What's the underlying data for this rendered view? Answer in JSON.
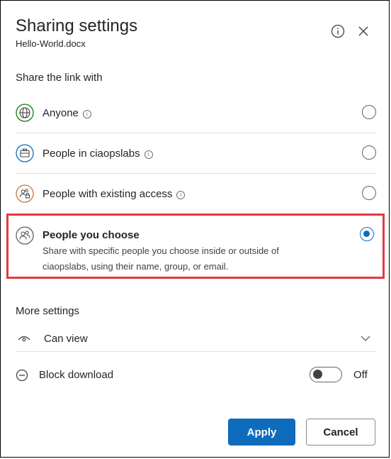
{
  "dialog": {
    "title": "Sharing settings",
    "filename": "Hello-World.docx"
  },
  "share_with": {
    "heading": "Share the link with",
    "options": [
      {
        "label": "Anyone",
        "icon": "globe-icon",
        "selected": false
      },
      {
        "label": "People in ciaopslabs",
        "icon": "org-icon",
        "selected": false
      },
      {
        "label": "People with existing access",
        "icon": "people-lock-icon",
        "selected": false
      },
      {
        "label": "People you choose",
        "icon": "people-icon",
        "selected": true,
        "description": "Share with specific people you choose inside or outside of ciaopslabs, using their name, group, or email."
      }
    ]
  },
  "more_settings": {
    "heading": "More settings",
    "permission": "Can view",
    "block_download_label": "Block download",
    "toggle_state": "Off"
  },
  "buttons": {
    "apply": "Apply",
    "cancel": "Cancel"
  },
  "colors": {
    "accent": "#0f6cbd",
    "highlight": "#e33940"
  }
}
